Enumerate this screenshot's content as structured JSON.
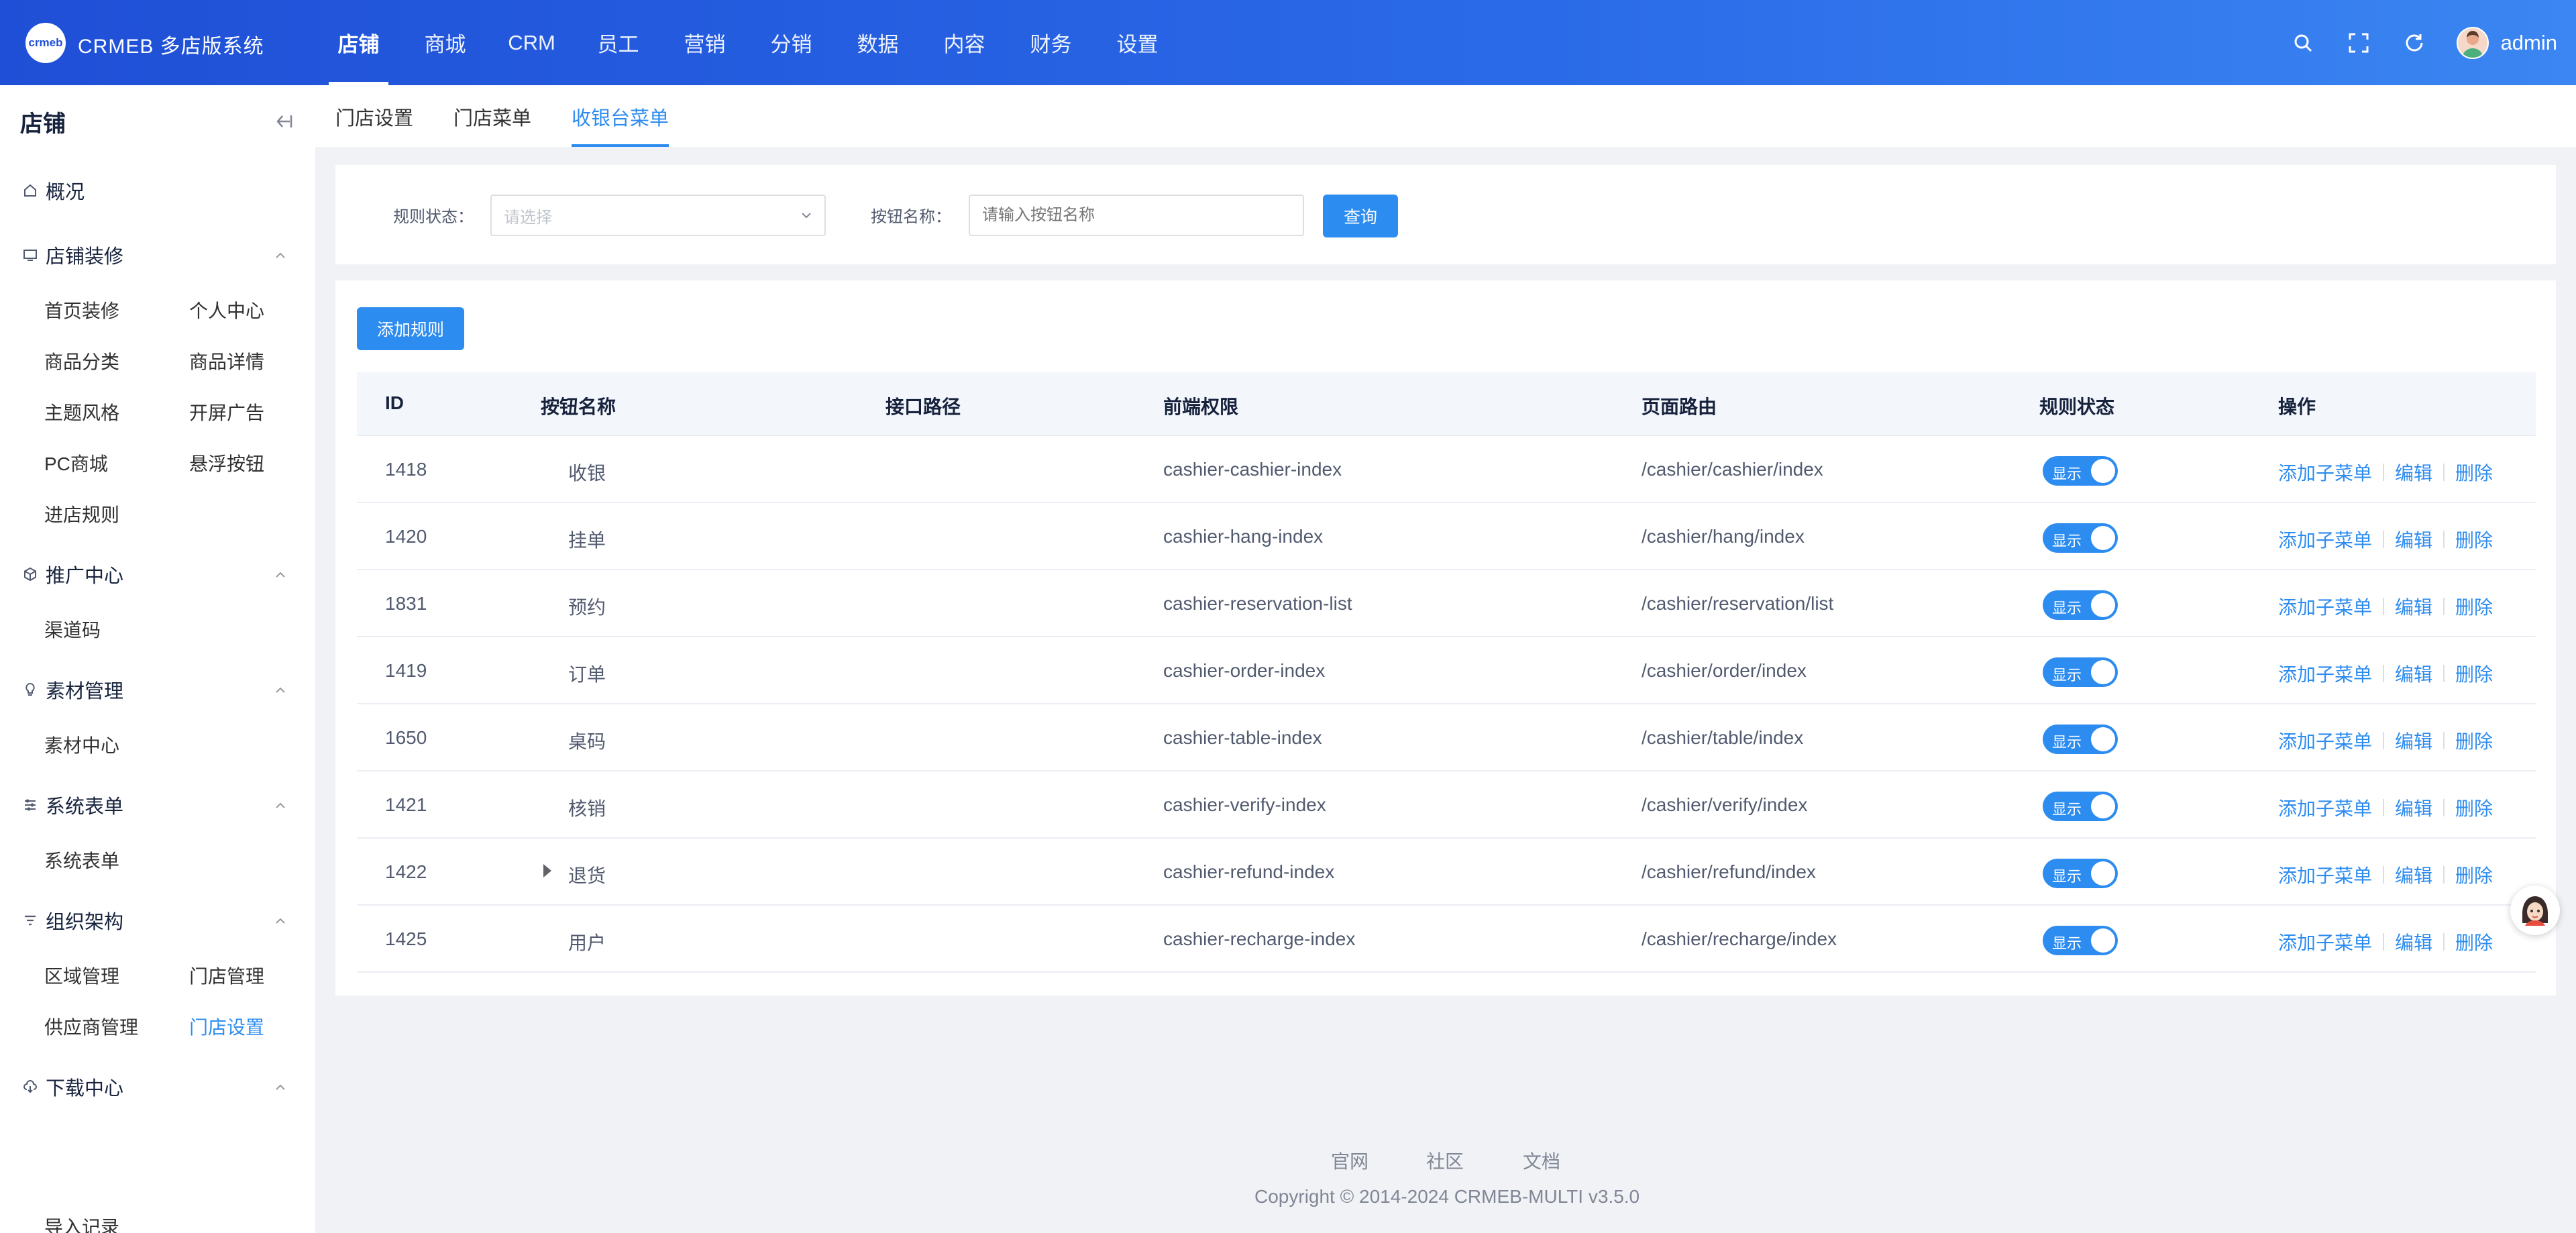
{
  "header": {
    "logo_text": "crmeb",
    "brand": "CRMEB 多店版系统",
    "nav": [
      "店铺",
      "商城",
      "CRM",
      "员工",
      "营销",
      "分销",
      "数据",
      "内容",
      "财务",
      "设置"
    ],
    "active_nav": "店铺",
    "username": "admin",
    "accent_color": "#2a6ae8"
  },
  "sidebar": {
    "title": "店铺",
    "overview": "概况",
    "groups": [
      {
        "label": "店铺装修",
        "icon": "monitor-icon",
        "items": [
          "首页装修",
          "个人中心",
          "商品分类",
          "商品详情",
          "主题风格",
          "开屏广告",
          "PC商城",
          "悬浮按钮",
          "进店规则"
        ]
      },
      {
        "label": "推广中心",
        "icon": "cube-icon",
        "items": [
          "渠道码"
        ]
      },
      {
        "label": "素材管理",
        "icon": "bulb-icon",
        "items": [
          "素材中心"
        ]
      },
      {
        "label": "系统表单",
        "icon": "form-icon",
        "items": [
          "系统表单"
        ]
      },
      {
        "label": "组织架构",
        "icon": "filter-icon",
        "items": [
          "区域管理",
          "门店管理",
          "供应商管理",
          "门店设置"
        ]
      },
      {
        "label": "下载中心",
        "icon": "cloud-download-icon",
        "items": [
          "导入记录"
        ]
      }
    ],
    "active_item": "门店设置"
  },
  "tabs": [
    "门店设置",
    "门店菜单",
    "收银台菜单"
  ],
  "active_tab": "收银台菜单",
  "filter": {
    "status_label": "规则状态：",
    "status_placeholder": "请选择",
    "name_label": "按钮名称：",
    "name_placeholder": "请输入按钮名称",
    "query_button": "查询"
  },
  "add_rule_button": "添加规则",
  "table": {
    "headers": [
      "ID",
      "按钮名称",
      "接口路径",
      "前端权限",
      "页面路由",
      "规则状态",
      "操作"
    ],
    "rows": [
      {
        "id": "1418",
        "name": "收银",
        "api": "",
        "perm": "cashier-cashier-index",
        "route": "/cashier/cashier/index",
        "status": "显示"
      },
      {
        "id": "1420",
        "name": "挂单",
        "api": "",
        "perm": "cashier-hang-index",
        "route": "/cashier/hang/index",
        "status": "显示"
      },
      {
        "id": "1831",
        "name": "预约",
        "api": "",
        "perm": "cashier-reservation-list",
        "route": "/cashier/reservation/list",
        "status": "显示"
      },
      {
        "id": "1419",
        "name": "订单",
        "api": "",
        "perm": "cashier-order-index",
        "route": "/cashier/order/index",
        "status": "显示"
      },
      {
        "id": "1650",
        "name": "桌码",
        "api": "",
        "perm": "cashier-table-index",
        "route": "/cashier/table/index",
        "status": "显示"
      },
      {
        "id": "1421",
        "name": "核销",
        "api": "",
        "perm": "cashier-verify-index",
        "route": "/cashier/verify/index",
        "status": "显示"
      },
      {
        "id": "1422",
        "name": "退货",
        "api": "",
        "perm": "cashier-refund-index",
        "route": "/cashier/refund/index",
        "status": "显示"
      },
      {
        "id": "1425",
        "name": "用户",
        "api": "",
        "perm": "cashier-recharge-index",
        "route": "/cashier/recharge/index",
        "status": "显示"
      }
    ],
    "ops": {
      "add_child": "添加子菜单",
      "edit": "编辑",
      "delete": "删除"
    }
  },
  "footer": {
    "links": [
      "官网",
      "社区",
      "文档"
    ],
    "copyright": "Copyright © 2014-2024 CRMEB-MULTI v3.5.0"
  }
}
